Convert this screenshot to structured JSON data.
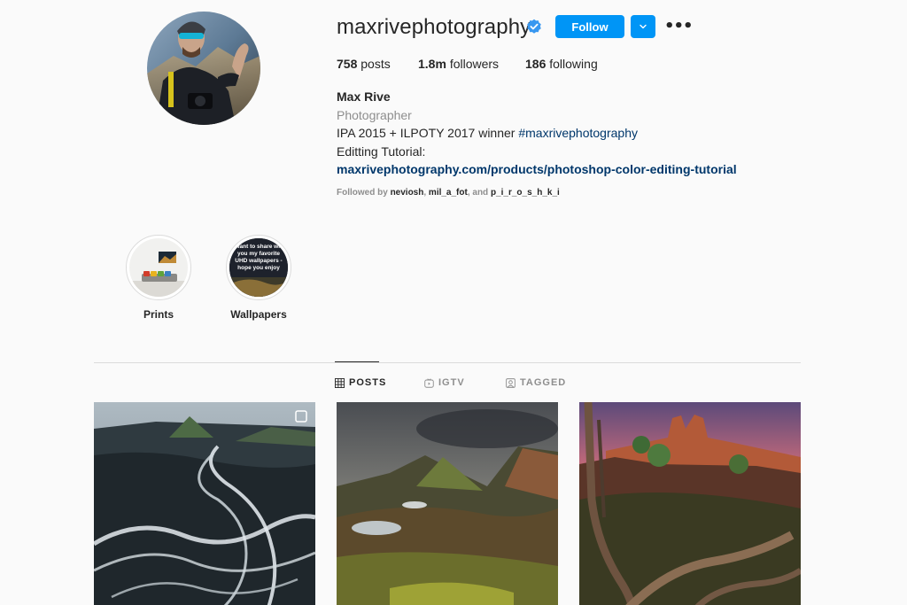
{
  "profile": {
    "username": "maxrivephotography",
    "follow_label": "Follow",
    "more_label": "•••"
  },
  "stats": {
    "posts_count": "758",
    "posts_label": "posts",
    "followers_count": "1.8m",
    "followers_label": "followers",
    "following_count": "186",
    "following_label": "following"
  },
  "bio": {
    "full_name": "Max Rive",
    "category": "Photographer",
    "line1_text": "IPA 2015 + ILPOTY 2017 winner ",
    "line1_hashtag": "#maxrivephotography",
    "line2": "Editting Tutorial:",
    "link": "maxrivephotography.com/products/photoshop-color-editing-tutorial"
  },
  "followed_by": {
    "prefix": "Followed by ",
    "user1": "neviosh",
    "sep1": ", ",
    "user2": "mil_a_fot",
    "sep2": ", and ",
    "user3": "p_i_r_o_s_h_k_i"
  },
  "highlights": [
    {
      "label": "Prints"
    },
    {
      "label": "Wallpapers",
      "cover_text": "I want to share with you my favorite UHD wallpapers - hope you enjoy"
    }
  ],
  "tabs": [
    {
      "label": "POSTS",
      "active": true
    },
    {
      "label": "IGTV",
      "active": false
    },
    {
      "label": "TAGGED",
      "active": false
    }
  ],
  "colors": {
    "accent": "#0095f6",
    "link": "#00376b",
    "muted": "#8e8e8e",
    "text": "#262626",
    "background": "#fafafa"
  }
}
